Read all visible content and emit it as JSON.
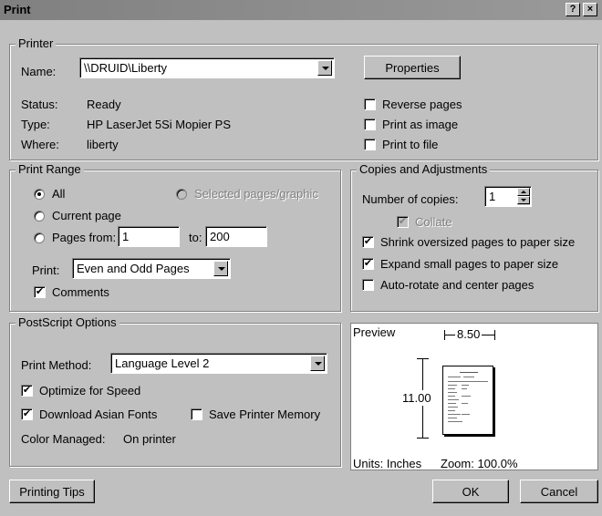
{
  "window": {
    "title": "Print",
    "help_label": "?",
    "close_label": "×"
  },
  "printer": {
    "legend": "Printer",
    "name_label": "Name:",
    "name_value": "\\\\DRUID\\Liberty",
    "properties_label": "Properties",
    "status_label": "Status:",
    "status_value": "Ready",
    "type_label": "Type:",
    "type_value": "HP LaserJet 5Si Mopier PS",
    "where_label": "Where:",
    "where_value": "liberty",
    "reverse_pages": "Reverse pages",
    "print_as_image": "Print as image",
    "print_to_file": "Print to file"
  },
  "print_range": {
    "legend": "Print Range",
    "all": "All",
    "selected": "Selected pages/graphic",
    "current_page": "Current page",
    "pages_from": "Pages from:",
    "from_value": "1",
    "to_label": "to:",
    "to_value": "200",
    "print_label": "Print:",
    "print_value": "Even and Odd Pages",
    "comments": "Comments"
  },
  "copies": {
    "legend": "Copies and Adjustments",
    "number_label": "Number of copies:",
    "number_value": "1",
    "collate": "Collate",
    "shrink": "Shrink oversized pages to paper size",
    "expand": "Expand small pages to paper size",
    "autorotate": "Auto-rotate and center pages"
  },
  "postscript": {
    "legend": "PostScript Options",
    "method_label": "Print Method:",
    "method_value": "Language Level 2",
    "optimize": "Optimize for Speed",
    "download_fonts": "Download Asian Fonts",
    "save_memory": "Save Printer Memory",
    "color_managed_label": "Color Managed:",
    "color_managed_value": "On printer"
  },
  "preview": {
    "label": "Preview",
    "width": "8.50",
    "height": "11.00",
    "units": "Units: Inches",
    "zoom": "Zoom: 100.0%"
  },
  "footer": {
    "tips": "Printing Tips",
    "ok": "OK",
    "cancel": "Cancel"
  },
  "check_glyph": "✔",
  "colors": {
    "face": "#c0c0c0",
    "title_bar": "#808080"
  }
}
